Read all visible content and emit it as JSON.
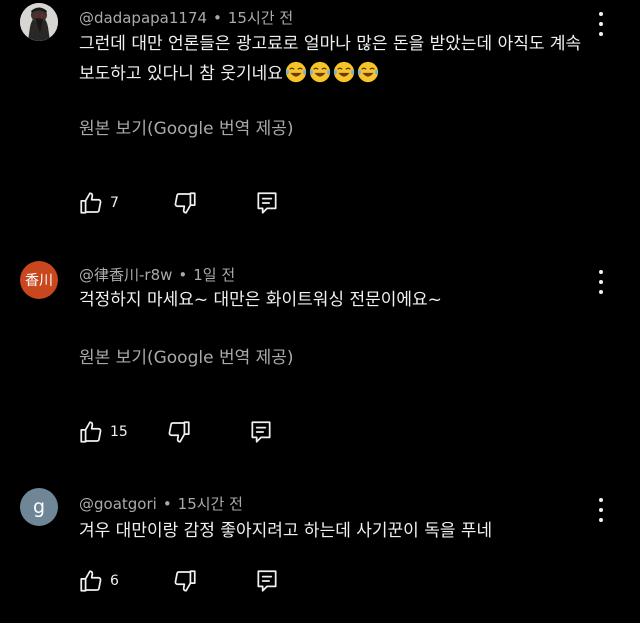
{
  "comments": [
    {
      "author": "@dadapapa1174",
      "time": "15시간 전",
      "text": "그런데 대만 언론들은 광고료로 얼마나 많은 돈을 받았는데 아직도 계속 보도하고 있다니 참 웃기네요",
      "emoji_count": 4,
      "emoji_icon": "face-with-tears-of-joy-icon",
      "translate_label": "원본 보기(Google 번역 제공)",
      "likes": "7",
      "avatar_type": "photo"
    },
    {
      "author": "@律香川-r8w",
      "time": "1일 전",
      "text": "걱정하지 마세요~ 대만은 화이트워싱 전문이에요~",
      "translate_label": "원본 보기(Google 번역 제공)",
      "likes": "15",
      "avatar_text": "香川",
      "avatar_color": "#c9471f"
    },
    {
      "author": "@goatgori",
      "time": "15시간 전",
      "text": "겨우 대만이랑 감정 좋아지려고 하는데 사기꾼이 독을 푸네",
      "likes": "6",
      "avatar_text": "g",
      "avatar_color": "#6f8696"
    }
  ],
  "separator": "•",
  "colors": {
    "background": "#000000",
    "primary_text": "#f1f1f1",
    "secondary_text": "#aaaaaa"
  }
}
